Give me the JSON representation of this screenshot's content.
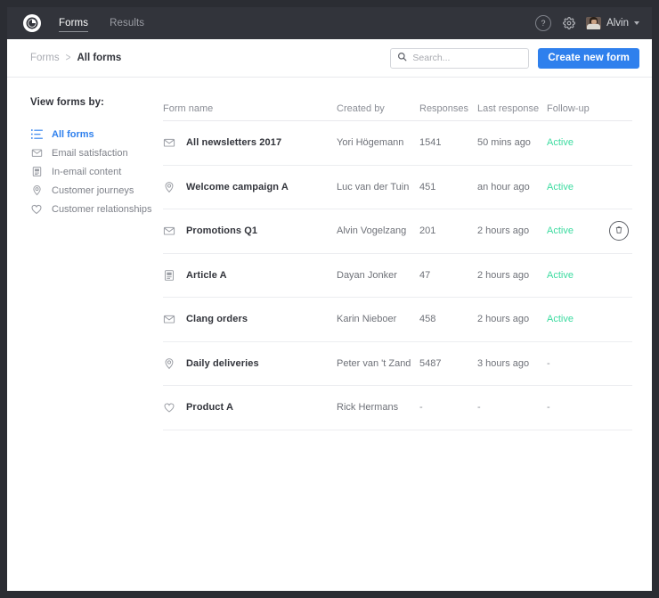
{
  "topbar": {
    "logo_icon": "spinner-logo-icon",
    "tabs": [
      {
        "label": "Forms",
        "active": true
      },
      {
        "label": "Results",
        "active": false
      }
    ],
    "help_label": "?",
    "help_icon": "question-mark-icon",
    "settings_icon": "gear-icon",
    "avatar_icon": "user-avatar",
    "user_name": "Alvin",
    "caret_icon": "chevron-down-icon"
  },
  "breadcrumb": {
    "parent": "Forms",
    "separator": ">",
    "current": "All forms"
  },
  "search": {
    "icon": "search-icon",
    "placeholder": "Search...",
    "value": ""
  },
  "actions": {
    "create_label": "Create new form"
  },
  "sidebar": {
    "title": "View forms by:",
    "items": [
      {
        "label": "All forms",
        "icon": "list-icon",
        "active": true
      },
      {
        "label": "Email satisfaction",
        "icon": "envelope-icon",
        "active": false
      },
      {
        "label": "In-email content",
        "icon": "document-icon",
        "active": false
      },
      {
        "label": "Customer journeys",
        "icon": "location-pin-icon",
        "active": false
      },
      {
        "label": "Customer relationships",
        "icon": "heart-icon",
        "active": false
      }
    ]
  },
  "table": {
    "columns": {
      "name": "Form name",
      "created_by": "Created by",
      "responses": "Responses",
      "last_response": "Last response",
      "follow_up": "Follow-up"
    },
    "rows": [
      {
        "icon": "envelope-icon",
        "name": "All newsletters 2017",
        "created_by": "Yori Högemann",
        "responses": "1541",
        "last_response": "50 mins ago",
        "follow_up": "Active",
        "follow_up_state": "active",
        "show_delete": false
      },
      {
        "icon": "location-pin-icon",
        "name": "Welcome campaign A",
        "created_by": "Luc van der Tuin",
        "responses": "451",
        "last_response": "an hour ago",
        "follow_up": "Active",
        "follow_up_state": "active",
        "show_delete": false
      },
      {
        "icon": "envelope-icon",
        "name": "Promotions Q1",
        "created_by": "Alvin Vogelzang",
        "responses": "201",
        "last_response": "2 hours ago",
        "follow_up": "Active",
        "follow_up_state": "active",
        "show_delete": true
      },
      {
        "icon": "document-icon",
        "name": "Article A",
        "created_by": "Dayan Jonker",
        "responses": "47",
        "last_response": "2 hours ago",
        "follow_up": "Active",
        "follow_up_state": "active",
        "show_delete": false
      },
      {
        "icon": "envelope-icon",
        "name": "Clang orders",
        "created_by": "Karin Nieboer",
        "responses": "458",
        "last_response": "2 hours ago",
        "follow_up": "Active",
        "follow_up_state": "active",
        "show_delete": false
      },
      {
        "icon": "location-pin-icon",
        "name": "Daily deliveries",
        "created_by": "Peter van 't Zand",
        "responses": "5487",
        "last_response": "3 hours ago",
        "follow_up": "-",
        "follow_up_state": "none",
        "show_delete": false
      },
      {
        "icon": "heart-icon",
        "name": "Product A",
        "created_by": "Rick Hermans",
        "responses": "-",
        "last_response": "-",
        "follow_up": "-",
        "follow_up_state": "none",
        "show_delete": false
      }
    ],
    "delete_icon": "trash-icon"
  },
  "colors": {
    "topbar_bg": "#32343b",
    "accent_blue": "#2f80ed",
    "status_green": "#3ddba0",
    "text_dark": "#32343b",
    "text_muted": "#8b8e96"
  }
}
